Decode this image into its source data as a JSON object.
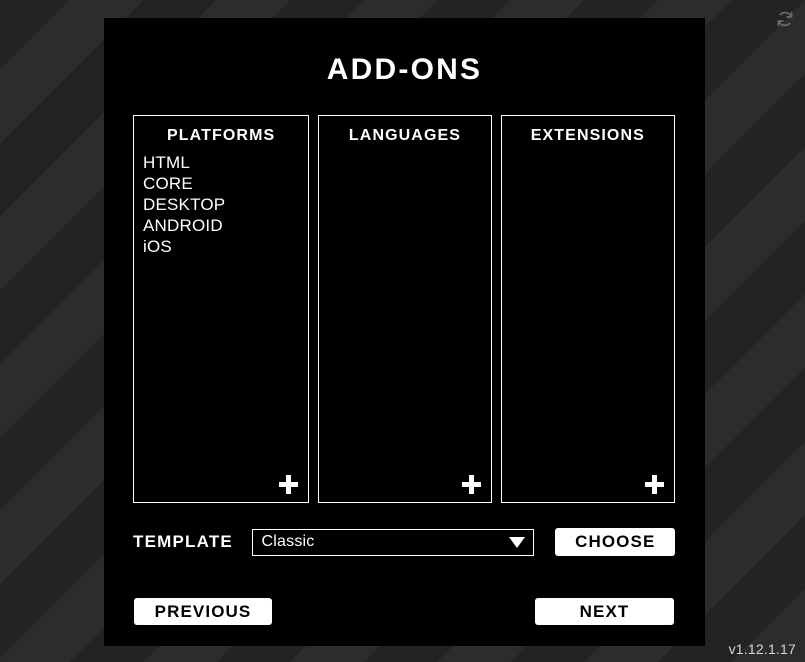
{
  "window": {
    "version_label": "v1.12.1.17",
    "refresh_icon": "refresh-icon"
  },
  "header": {
    "title": "ADD-ONS"
  },
  "columns": [
    {
      "key": "platforms",
      "header": "PLATFORMS",
      "add_icon": "plus-icon",
      "items": [
        "HTML",
        "CORE",
        "DESKTOP",
        "ANDROID",
        "iOS"
      ]
    },
    {
      "key": "languages",
      "header": "LANGUAGES",
      "add_icon": "plus-icon",
      "items": []
    },
    {
      "key": "extensions",
      "header": "EXTENSIONS",
      "add_icon": "plus-icon",
      "items": []
    }
  ],
  "template": {
    "label": "TEMPLATE",
    "selected": "Classic",
    "options": [
      "Classic"
    ],
    "caret_icon": "chevron-down-icon",
    "choose_label": "CHOOSE"
  },
  "navigation": {
    "previous_label": "PREVIOUS",
    "next_label": "NEXT"
  },
  "colors": {
    "panel_background": "#000000",
    "desktop_background": "#262626",
    "accent": "#ffffff",
    "version_text": "#d6d6d6"
  }
}
